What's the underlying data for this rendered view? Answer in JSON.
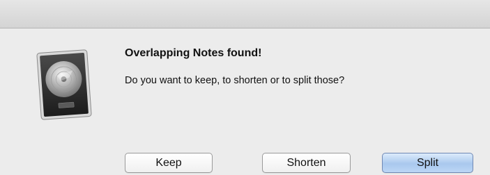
{
  "dialog": {
    "title": "Overlapping Notes found!",
    "message": "Do you want to keep, to shorten or to split those?",
    "icon": "logic-app-icon"
  },
  "buttons": {
    "keep_label": "Keep",
    "shorten_label": "Shorten",
    "split_label": "Split",
    "default_button": "Split"
  },
  "colors": {
    "background": "#ececec",
    "default_button": "#a9c8ee"
  }
}
